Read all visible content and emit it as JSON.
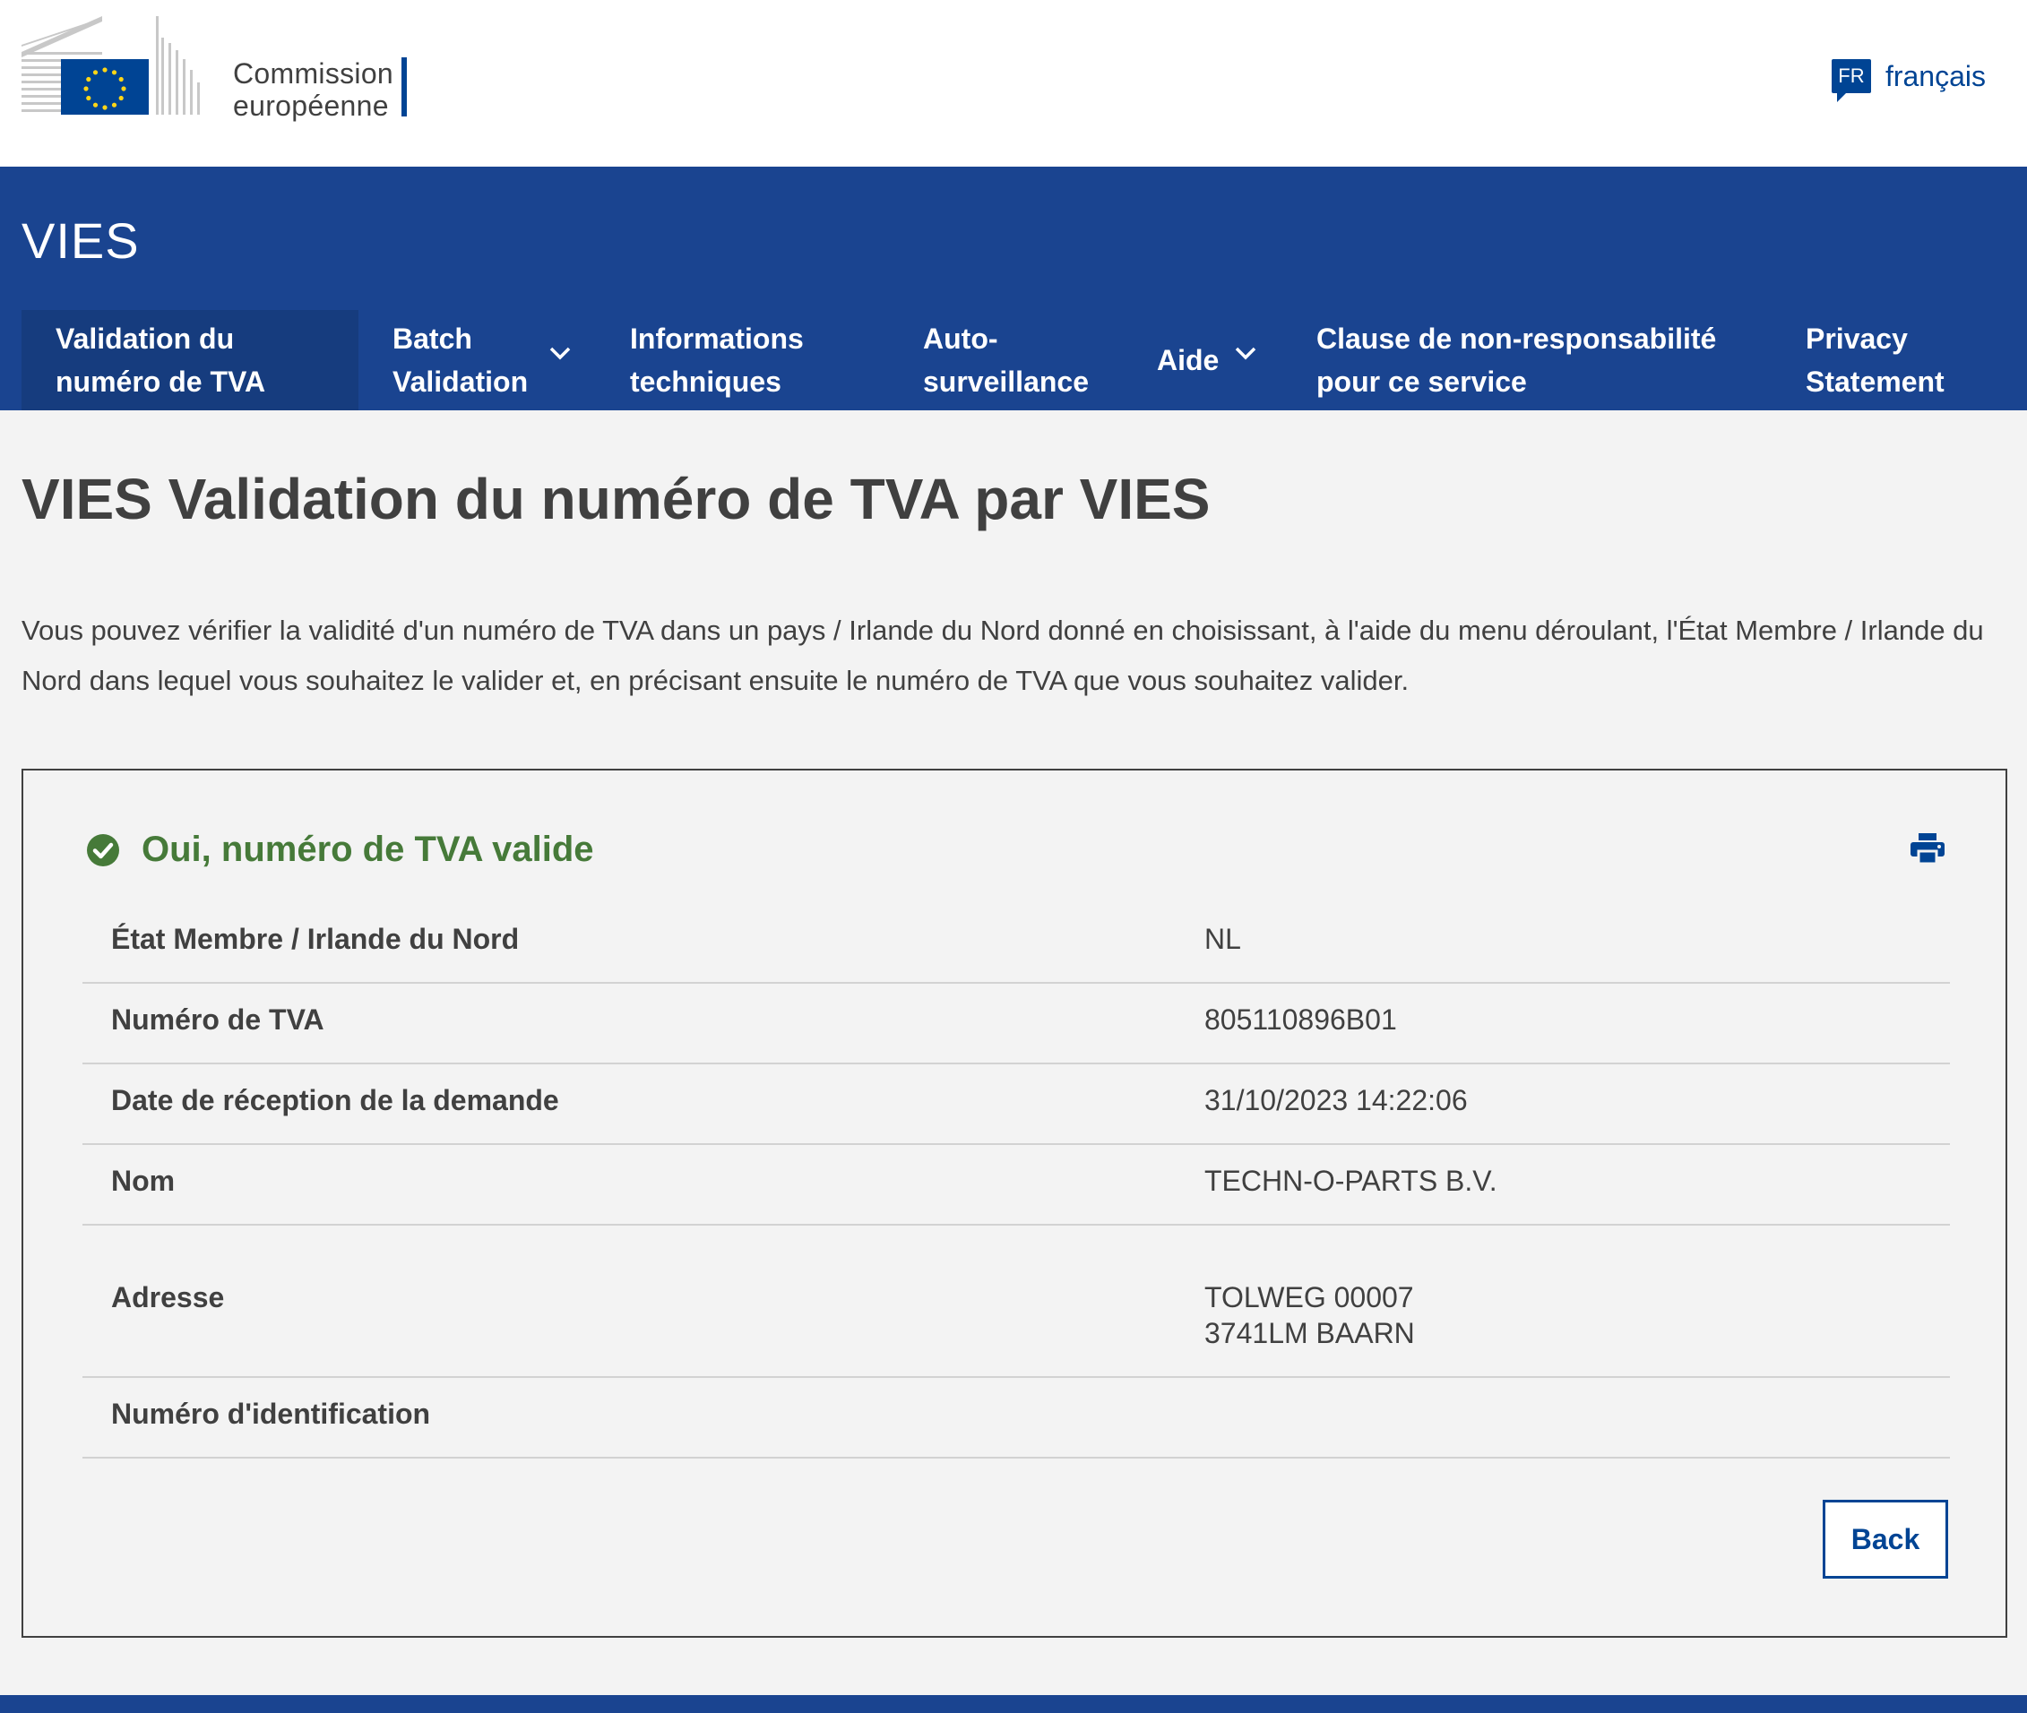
{
  "brand": {
    "name_line1": "Commission",
    "name_line2": "européenne"
  },
  "language": {
    "code": "FR",
    "label": "français"
  },
  "site": {
    "title": "VIES"
  },
  "nav": {
    "items": [
      {
        "line1": "Validation du",
        "line2": "numéro de TVA",
        "active": true
      },
      {
        "line1": "Batch",
        "line2": "Validation",
        "has_dropdown": true
      },
      {
        "line1": "Informations",
        "line2": "techniques"
      },
      {
        "line1": "Auto-",
        "line2": "surveillance"
      },
      {
        "line1": "Aide",
        "has_dropdown": true
      },
      {
        "line1": "Clause de non-responsabilité",
        "line2": "pour ce service"
      },
      {
        "line1": "Privacy",
        "line2": "Statement"
      }
    ]
  },
  "page": {
    "title": "VIES Validation du numéro de TVA par VIES",
    "intro": "Vous pouvez vérifier la validité d'un numéro de TVA dans un pays / Irlande du Nord donné en choisissant, à l'aide du menu déroulant, l'État Membre / Irlande du Nord dans lequel vous souhaitez le valider et, en précisant ensuite le numéro de TVA que vous souhaitez valider."
  },
  "result": {
    "status": "Oui, numéro de TVA valide",
    "rows": [
      {
        "label": "État Membre / Irlande du Nord",
        "value": "NL"
      },
      {
        "label": "Numéro de TVA",
        "value": "805110896B01"
      },
      {
        "label": "Date de réception de la demande",
        "value": "31/10/2023 14:22:06"
      },
      {
        "label": "Nom",
        "value": "TECHN-O-PARTS B.V."
      },
      {
        "label": "Adresse",
        "value_line1": "TOLWEG 00007",
        "value_line2": "3741LM BAARN"
      },
      {
        "label": "Numéro d'identification",
        "value": ""
      }
    ],
    "back_label": "Back"
  },
  "colors": {
    "brand_blue": "#004494",
    "header_blue": "#1a4490",
    "nav_active": "#163c7e",
    "success_green": "#467a39",
    "eu_yellow": "#ffd617"
  },
  "icons": {
    "status": "check-circle-icon",
    "print": "printer-icon",
    "dropdown": "chevron-down-icon",
    "language": "speech-bubble-icon"
  }
}
